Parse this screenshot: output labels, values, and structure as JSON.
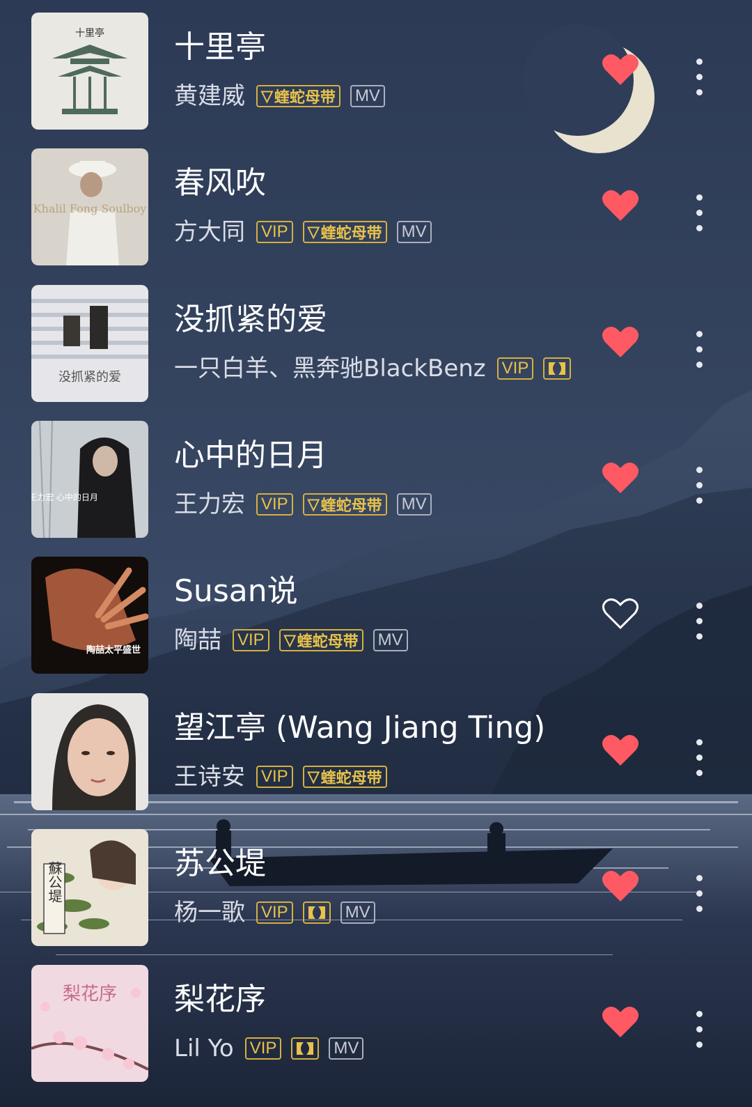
{
  "colors": {
    "heart_filled": "#ff5a63",
    "badge_gold": "#e8c24a",
    "badge_grey": "#c8ccd6",
    "title": "#ffffff",
    "artist": "#d9dde6"
  },
  "songs": [
    {
      "title": "十里亭",
      "artist": "黄建威",
      "liked": true,
      "badges": [
        {
          "type": "vv",
          "label": "蝰蛇母带"
        },
        {
          "type": "mv",
          "label": "MV"
        }
      ],
      "cover_text": "十里亭",
      "cover_icon": "pavilion-cover"
    },
    {
      "title": "春风吹",
      "artist": "方大同",
      "liked": true,
      "badges": [
        {
          "type": "vip",
          "label": "VIP"
        },
        {
          "type": "vv",
          "label": "蝰蛇母带"
        },
        {
          "type": "mv",
          "label": "MV"
        }
      ],
      "cover_text": "Khalil Fong Soulboy",
      "cover_icon": "singer-hat-cover"
    },
    {
      "title": "没抓紧的爱",
      "artist": "一只白羊、黑奔驰BlackBenz",
      "liked": true,
      "badges": [
        {
          "type": "vip",
          "label": "VIP"
        },
        {
          "type": "dolby",
          "label": ""
        }
      ],
      "cover_text": "没抓紧的爱",
      "cover_icon": "window-light-cover"
    },
    {
      "title": "心中的日月",
      "artist": "王力宏",
      "liked": true,
      "badges": [
        {
          "type": "vip",
          "label": "VIP"
        },
        {
          "type": "vv",
          "label": "蝰蛇母带"
        },
        {
          "type": "mv",
          "label": "MV"
        }
      ],
      "cover_text": "王力宏 心中的日月",
      "cover_icon": "singer-hoodie-cover"
    },
    {
      "title": "Susan说",
      "artist": "陶喆",
      "liked": false,
      "badges": [
        {
          "type": "vip",
          "label": "VIP"
        },
        {
          "type": "vv",
          "label": "蝰蛇母带"
        },
        {
          "type": "mv",
          "label": "MV"
        }
      ],
      "cover_text": "陶喆太平盛世",
      "cover_icon": "hand-face-cover"
    },
    {
      "title": "望江亭 (Wang Jiang Ting)",
      "artist": "王诗安",
      "liked": true,
      "badges": [
        {
          "type": "vip",
          "label": "VIP"
        },
        {
          "type": "vv",
          "label": "蝰蛇母带"
        }
      ],
      "cover_text": "",
      "cover_icon": "portrait-woman-cover"
    },
    {
      "title": "苏公堤",
      "artist": "杨一歌",
      "liked": true,
      "badges": [
        {
          "type": "vip",
          "label": "VIP"
        },
        {
          "type": "dolby",
          "label": ""
        },
        {
          "type": "mv",
          "label": "MV"
        }
      ],
      "cover_text": "蘇公堤",
      "cover_icon": "bamboo-girl-cover"
    },
    {
      "title": "梨花序",
      "artist": "Lil Yo",
      "liked": true,
      "badges": [
        {
          "type": "vip",
          "label": "VIP"
        },
        {
          "type": "dolby",
          "label": ""
        },
        {
          "type": "mv",
          "label": "MV"
        }
      ],
      "cover_text": "梨花序",
      "cover_icon": "pear-blossom-cover"
    }
  ]
}
